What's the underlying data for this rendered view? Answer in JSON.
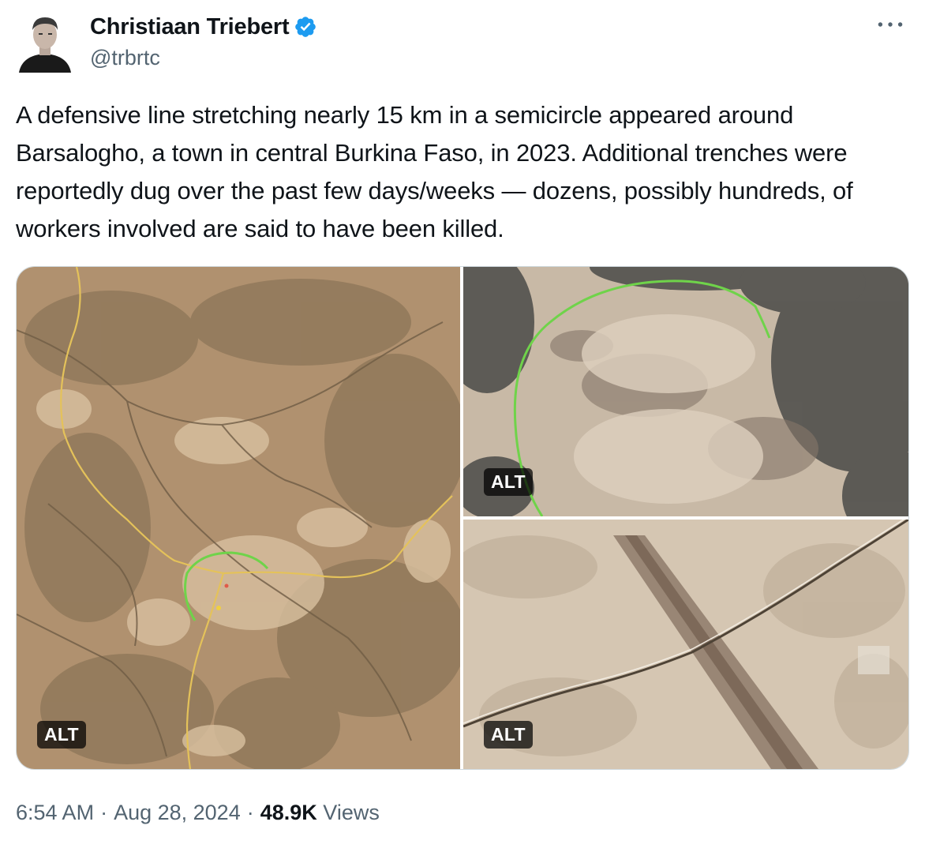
{
  "author": {
    "name": "Christiaan Triebert",
    "handle": "@trbrtc",
    "verified": true
  },
  "icons": {
    "avatar": "profile-photo",
    "verified": "verified-badge-icon",
    "more": "more-icon"
  },
  "tweet": {
    "text": "A defensive line stretching nearly 15 km in a semicircle appeared around Barsalogho, a town in central Burkina Faso, in 2023. Additional trenches were reportedly dug over the past few days/weeks — dozens, possibly hundreds, of workers involved are said to have been killed."
  },
  "media": [
    {
      "alt_label": "ALT"
    },
    {
      "alt_label": "ALT"
    },
    {
      "alt_label": "ALT"
    }
  ],
  "meta": {
    "time": "6:54 AM",
    "separator": "·",
    "date": "Aug 28, 2024",
    "views_count": "48.9K",
    "views_label": "Views"
  },
  "colors": {
    "text": "#0f1419",
    "secondary": "#536471",
    "verified": "#1d9bf0",
    "trench_line": "#6fd34a",
    "road": "#e4c25a"
  }
}
